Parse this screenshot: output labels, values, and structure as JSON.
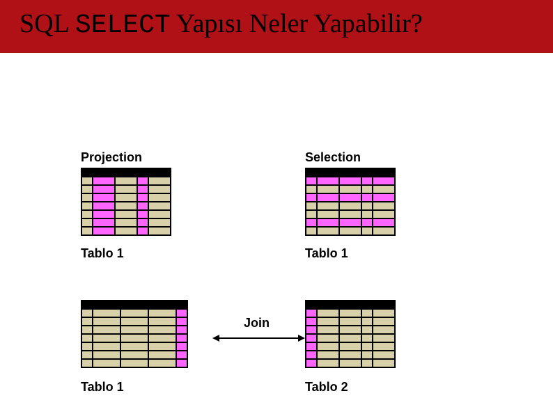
{
  "title": {
    "pre": "SQL ",
    "mono": "SELECT",
    "post": " Yapısı Neler Yapabilir?"
  },
  "labels": {
    "projection": "Projection",
    "selection": "Selection",
    "join": "Join",
    "table1_a": "Tablo 1",
    "table1_b": "Tablo 1",
    "table1_c": "Tablo 1",
    "table2": "Tablo 2"
  }
}
